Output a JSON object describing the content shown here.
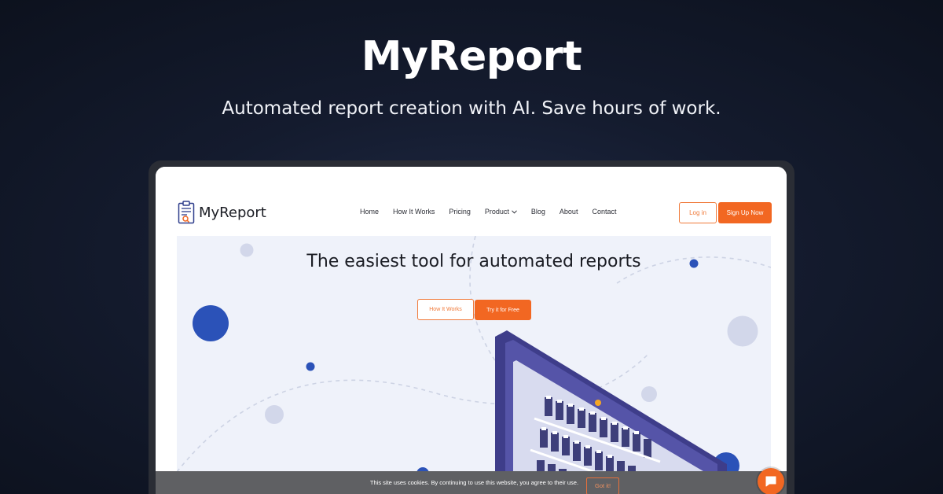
{
  "hero": {
    "title": "MyReport",
    "subtitle": "Automated report creation with AI. Save hours of work."
  },
  "site": {
    "logo_text": "MyReport",
    "nav": [
      "Home",
      "How It Works",
      "Pricing",
      "Product",
      "Blog",
      "About",
      "Contact"
    ],
    "login_label": "Log in",
    "signup_label": "Sign Up Now",
    "headline": "The easiest tool for automated reports",
    "how_it_works_label": "How It Works",
    "try_free_label": "Try it for Free"
  },
  "cookie": {
    "text": "This site uses cookies. By continuing to use this website, you agree to their use.",
    "button_label": "Got it!"
  },
  "colors": {
    "accent": "#f26722",
    "brand_blue": "#2b52b8",
    "screen_purple": "#4a4a9a"
  },
  "icons": {
    "logo": "clipboard-report-icon",
    "product_dropdown": "chevron-down-icon",
    "chat": "chat-bubble-icon"
  }
}
